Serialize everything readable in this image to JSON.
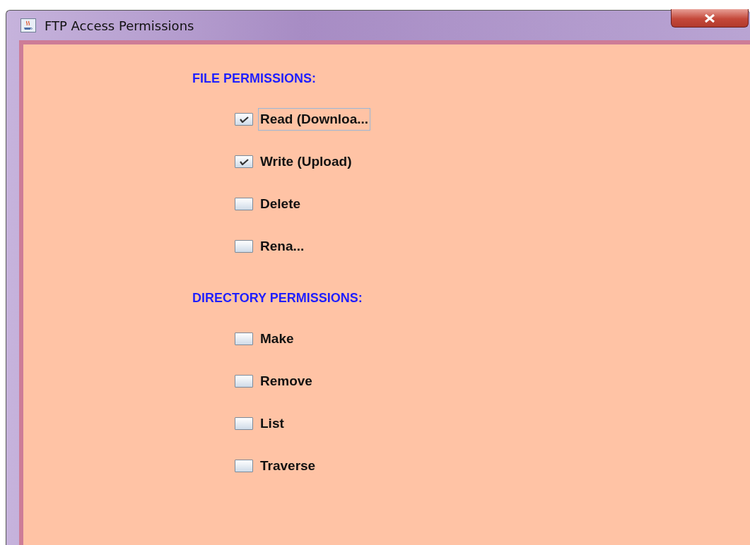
{
  "window": {
    "title": "FTP Access Permissions"
  },
  "sections": [
    {
      "heading": "FILE PERMISSIONS:",
      "options": [
        {
          "label": "Read (Downloa...",
          "checked": true,
          "focused": true
        },
        {
          "label": "Write (Upload)",
          "checked": true,
          "focused": false
        },
        {
          "label": "Delete",
          "checked": false,
          "focused": false
        },
        {
          "label": "Rena...",
          "checked": false,
          "focused": false
        }
      ]
    },
    {
      "heading": "DIRECTORY PERMISSIONS:",
      "options": [
        {
          "label": "Make",
          "checked": false,
          "focused": false
        },
        {
          "label": "Remove",
          "checked": false,
          "focused": false
        },
        {
          "label": "List",
          "checked": false,
          "focused": false
        },
        {
          "label": "Traverse",
          "checked": false,
          "focused": false
        }
      ]
    }
  ]
}
